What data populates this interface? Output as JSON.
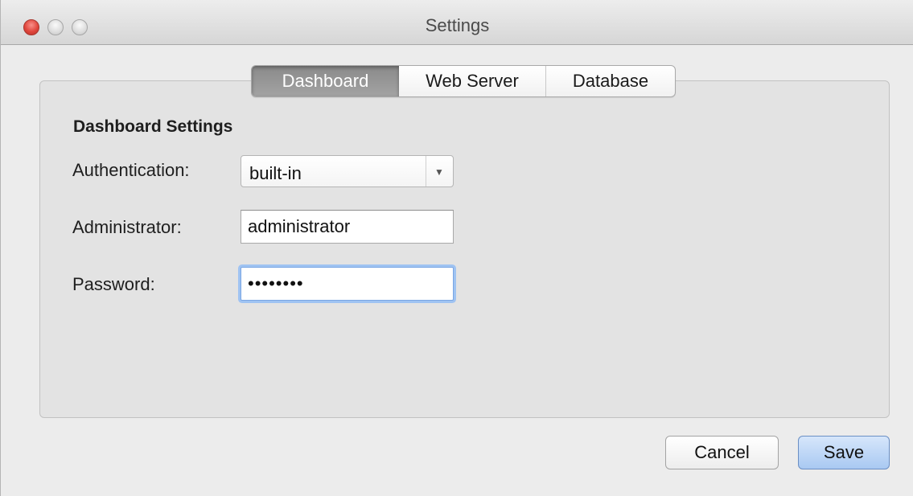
{
  "window": {
    "title": "Settings"
  },
  "tabs": [
    {
      "label": "Dashboard",
      "selected": true
    },
    {
      "label": "Web Server",
      "selected": false
    },
    {
      "label": "Database",
      "selected": false
    }
  ],
  "dashboard": {
    "section_title": "Dashboard Settings",
    "authentication": {
      "label": "Authentication:",
      "selected_value": "built-in"
    },
    "administrator": {
      "label": "Administrator:",
      "value": "administrator"
    },
    "password": {
      "label": "Password:",
      "masked_value": "••••••••"
    }
  },
  "buttons": {
    "cancel_label": "Cancel",
    "save_label": "Save"
  },
  "colors": {
    "close_button": "#e0463c",
    "focus_ring": "#9fc3f2",
    "default_button": "#a9c9f2",
    "selected_tab": "#8a8a8a"
  },
  "icons": {
    "dropdown": "chevron-down-icon"
  }
}
